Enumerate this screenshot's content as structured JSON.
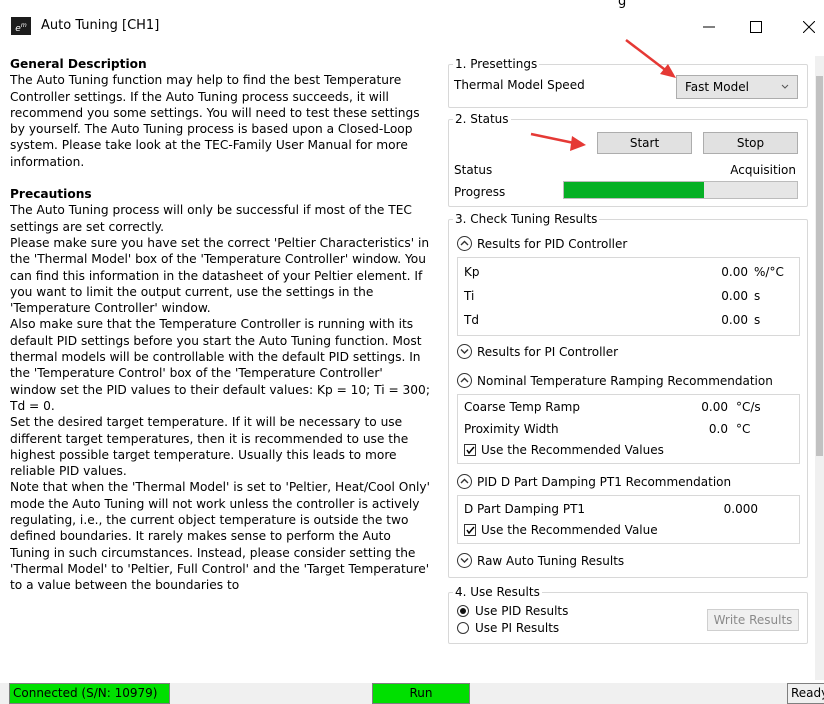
{
  "window": {
    "title": "Auto Tuning [CH1]",
    "logo_text": "e",
    "logo_sup": "m",
    "top_tail": "g"
  },
  "description": {
    "general_title": "General Description",
    "general_text": "The Auto Tuning function may help to find the best Temperature Controller settings. If the Auto Tuning process succeeds, it will recommend you some settings. You will need to test these settings by yourself. The Auto Tuning process is based upon a Closed-Loop system. Please take look at the TEC-Family User Manual for more information.",
    "precautions_title": "Precautions",
    "precautions": [
      "The Auto Tuning process will only be successful if most of the TEC settings are set correctly.",
      "Please make sure you have set the correct 'Peltier Characteristics' in the 'Thermal Model' box of the 'Temperature Controller' window. You can find this information in the datasheet of your Peltier element. If you want to limit the output current, use the settings in the 'Temperature Controller' window.",
      "Also make sure that the Temperature Controller is running with its default PID settings before you start the Auto Tuning function. Most thermal models will be controllable with the default PID settings. In the 'Temperature Control' box of the 'Temperature Controller' window set the PID values to their default values: Kp = 10; Ti = 300; Td = 0.",
      "Set the desired target temperature. If it will be necessary to use different target temperatures, then it is recommended to use the highest possible target temperature. Usually this leads to more reliable PID values.",
      "Note that when the 'Thermal Model' is set to 'Peltier, Heat/Cool Only' mode the Auto Tuning will not work unless the controller is actively regulating, i.e., the current object temperature is outside the two defined boundaries. It rarely makes sense to perform the Auto Tuning in such circumstances. Instead, please consider setting the 'Thermal Model' to 'Peltier, Full Control' and the 'Target Temperature' to a value between the boundaries to"
    ]
  },
  "presettings": {
    "legend": "1. Presettings",
    "label": "Thermal Model Speed",
    "selected": "Fast Model"
  },
  "status": {
    "legend": "2. Status",
    "start": "Start",
    "stop": "Stop",
    "status_label": "Status",
    "status_value": "Acquisition",
    "progress_label": "Progress",
    "progress": 0.6
  },
  "check": {
    "legend": "3. Check Tuning Results",
    "pid_header": "Results for PID Controller",
    "pid": [
      {
        "name": "Kp",
        "value": "0.00",
        "unit": "%/°C"
      },
      {
        "name": "Ti",
        "value": "0.00",
        "unit": "s"
      },
      {
        "name": "Td",
        "value": "0.00",
        "unit": "s"
      }
    ],
    "pi_header": "Results for PI Controller",
    "ramp_header": "Nominal Temperature Ramping Recommendation",
    "ramp": [
      {
        "name": "Coarse Temp Ramp",
        "value": "0.00",
        "unit": "°C/s"
      },
      {
        "name": "Proximity Width",
        "value": "0.0",
        "unit": "°C"
      }
    ],
    "ramp_checkbox": "Use the Recommended Values",
    "damp_header": "PID D Part Damping PT1 Recommendation",
    "damp_name": "D Part Damping PT1",
    "damp_value": "0.000",
    "damp_checkbox": "Use the Recommended Value",
    "raw_header": "Raw Auto Tuning Results"
  },
  "use": {
    "legend": "4. Use Results",
    "pid_option": "Use PID Results",
    "pi_option": "Use PI Results",
    "write": "Write Results"
  },
  "statusbar": {
    "connected": "Connected (S/N: 10979)",
    "run": "Run",
    "ready": "Ready"
  },
  "colors": {
    "progress": "#06b025",
    "status_green": "#00e000",
    "arrow": "#e53935"
  }
}
